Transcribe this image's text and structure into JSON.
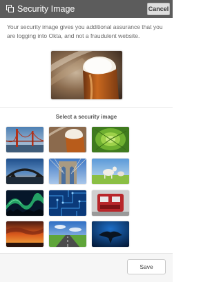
{
  "header": {
    "title": "Security Image",
    "cancel_label": "Cancel",
    "icon": "copy-icon"
  },
  "intro_text": "Your security image gives you additional assurance that you are logging into Okta, and not a fraudulent website.",
  "selected_image": {
    "subject": "beer-glass"
  },
  "select_label": "Select a security image",
  "images": [
    {
      "subject": "golden-gate-bridge"
    },
    {
      "subject": "beer-glass"
    },
    {
      "subject": "green-succulent"
    },
    {
      "subject": "harbour-bridge-sunset"
    },
    {
      "subject": "brooklyn-bridge"
    },
    {
      "subject": "goats-in-field"
    },
    {
      "subject": "aurora-borealis"
    },
    {
      "subject": "blue-circuit-board"
    },
    {
      "subject": "red-machine"
    },
    {
      "subject": "orange-sunset-clouds"
    },
    {
      "subject": "open-road"
    },
    {
      "subject": "manta-ray"
    }
  ],
  "footer": {
    "save_label": "Save"
  }
}
